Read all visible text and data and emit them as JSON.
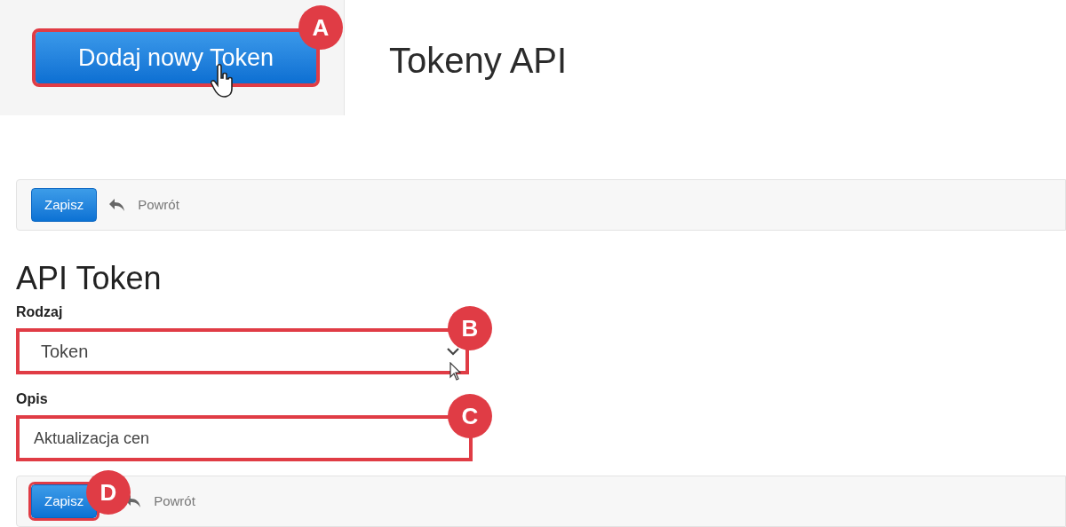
{
  "header": {
    "add_button": {
      "label": "Dodaj nowy Token",
      "marker": "A"
    },
    "title": "Tokeny API"
  },
  "top_toolbar": {
    "save": {
      "label": "Zapisz"
    },
    "back": {
      "label": "Powrót"
    }
  },
  "form": {
    "title": "API Token",
    "type_field": {
      "label": "Rodzaj",
      "value": "Token",
      "marker": "B"
    },
    "description_field": {
      "label": "Opis",
      "value": "Aktualizacja cen",
      "marker": "C"
    }
  },
  "bottom_toolbar": {
    "save": {
      "label": "Zapisz",
      "marker": "D"
    },
    "back": {
      "label": "Powrót"
    }
  }
}
